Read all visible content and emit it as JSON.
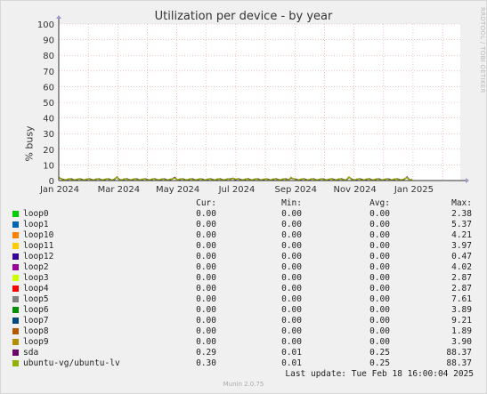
{
  "watermark": "RRDTOOL / TOBI OETIKER",
  "footer": "Munin 2.0.75",
  "last_update": "Last update: Tue Feb 18 16:00:04 2025",
  "legend_headers": {
    "cur": "Cur:",
    "min": "Min:",
    "avg": "Avg:",
    "max": "Max:"
  },
  "chart_data": {
    "type": "line",
    "title": "Utilization per device - by year",
    "ylabel": "% busy",
    "ylim": [
      0,
      100
    ],
    "yticks": [
      "0",
      "10",
      "20",
      "30",
      "40",
      "50",
      "60",
      "70",
      "80",
      "90",
      "100"
    ],
    "xticks": [
      "Jan 2024",
      "Mar 2024",
      "May 2024",
      "Jul 2024",
      "Sep 2024",
      "Nov 2024",
      "Jan 2025"
    ],
    "grid": true,
    "series": [
      {
        "name": "loop0",
        "color": "#00cc00",
        "cur": "0.00",
        "min": "0.00",
        "avg": "0.00",
        "max": "2.38"
      },
      {
        "name": "loop1",
        "color": "#0066b3",
        "cur": "0.00",
        "min": "0.00",
        "avg": "0.00",
        "max": "5.37"
      },
      {
        "name": "loop10",
        "color": "#ff8000",
        "cur": "0.00",
        "min": "0.00",
        "avg": "0.00",
        "max": "4.21"
      },
      {
        "name": "loop11",
        "color": "#ffcc00",
        "cur": "0.00",
        "min": "0.00",
        "avg": "0.00",
        "max": "3.97"
      },
      {
        "name": "loop12",
        "color": "#330099",
        "cur": "0.00",
        "min": "0.00",
        "avg": "0.00",
        "max": "0.47"
      },
      {
        "name": "loop2",
        "color": "#990099",
        "cur": "0.00",
        "min": "0.00",
        "avg": "0.00",
        "max": "4.02"
      },
      {
        "name": "loop3",
        "color": "#ccff00",
        "cur": "0.00",
        "min": "0.00",
        "avg": "0.00",
        "max": "2.87"
      },
      {
        "name": "loop4",
        "color": "#ff0000",
        "cur": "0.00",
        "min": "0.00",
        "avg": "0.00",
        "max": "2.87"
      },
      {
        "name": "loop5",
        "color": "#808080",
        "cur": "0.00",
        "min": "0.00",
        "avg": "0.00",
        "max": "7.61"
      },
      {
        "name": "loop6",
        "color": "#008f00",
        "cur": "0.00",
        "min": "0.00",
        "avg": "0.00",
        "max": "3.89"
      },
      {
        "name": "loop7",
        "color": "#00487d",
        "cur": "0.00",
        "min": "0.00",
        "avg": "0.00",
        "max": "9.21"
      },
      {
        "name": "loop8",
        "color": "#b35a00",
        "cur": "0.00",
        "min": "0.00",
        "avg": "0.00",
        "max": "1.89"
      },
      {
        "name": "loop9",
        "color": "#b38f00",
        "cur": "0.00",
        "min": "0.00",
        "avg": "0.00",
        "max": "3.90"
      },
      {
        "name": "sda",
        "color": "#6b006b",
        "cur": "0.29",
        "min": "0.01",
        "avg": "0.25",
        "max": "88.37"
      },
      {
        "name": "ubuntu-vg/ubuntu-lv",
        "color": "#8fb300",
        "cur": "0.30",
        "min": "0.01",
        "avg": "0.25",
        "max": "88.37"
      }
    ]
  }
}
